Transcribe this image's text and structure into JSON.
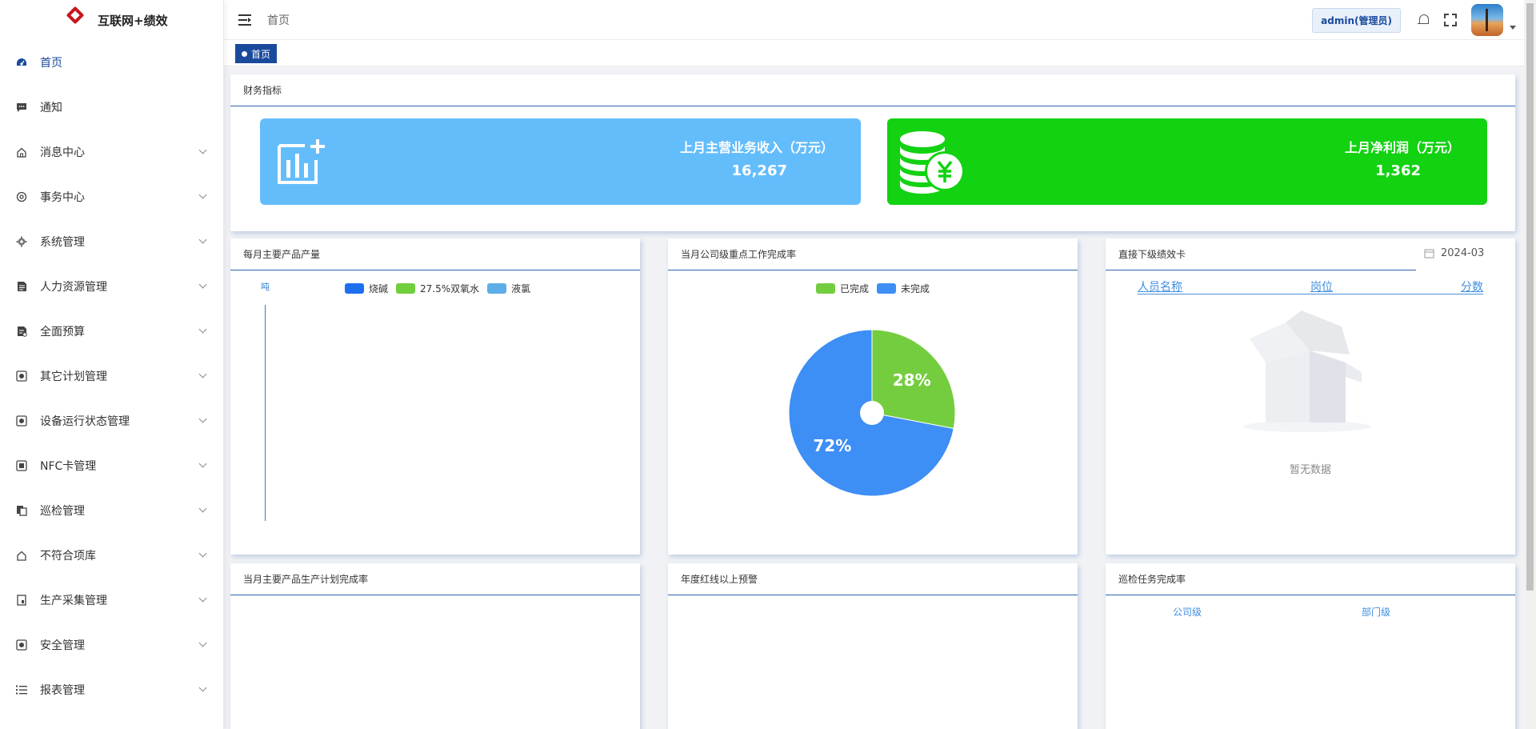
{
  "app": {
    "title": "互联网+绩效"
  },
  "sidebar": {
    "items": [
      {
        "label": "首页",
        "icon": "dashboard-icon",
        "active": true
      },
      {
        "label": "通知",
        "icon": "message-icon"
      },
      {
        "label": "消息中心",
        "icon": "home-icon"
      },
      {
        "label": "事务中心",
        "icon": "settings-circle-icon"
      },
      {
        "label": "系统管理",
        "icon": "gear-icon"
      },
      {
        "label": "人力资源管理",
        "icon": "document-icon"
      },
      {
        "label": "全面预算",
        "icon": "budget-doc-icon"
      },
      {
        "label": "其它计划管理",
        "icon": "plan-icon"
      },
      {
        "label": "设备运行状态管理",
        "icon": "device-icon"
      },
      {
        "label": "NFC卡管理",
        "icon": "nfc-icon"
      },
      {
        "label": "巡检管理",
        "icon": "copy-icon"
      },
      {
        "label": "不符合项库",
        "icon": "house-icon"
      },
      {
        "label": "生产采集管理",
        "icon": "collect-icon"
      },
      {
        "label": "安全管理",
        "icon": "safety-icon"
      },
      {
        "label": "报表管理",
        "icon": "list-icon"
      }
    ]
  },
  "header": {
    "breadcrumb": "首页",
    "user_label": "admin(管理员)"
  },
  "tags": {
    "active": "首页"
  },
  "finance": {
    "title": "财务指标",
    "revenue": {
      "label": "上月主营业务收入（万元）",
      "value": "16,267",
      "color": "#64bdfb"
    },
    "profit": {
      "label": "上月净利润（万元）",
      "value": "1,362",
      "color": "#12d212"
    }
  },
  "output_card": {
    "title": "每月主要产品产量",
    "unit": "吨",
    "legend": [
      {
        "name": "烧碱",
        "color": "#1e6ff0"
      },
      {
        "name": "27.5%双氧水",
        "color": "#6fcf3c"
      },
      {
        "name": "液氯",
        "color": "#5dade8"
      }
    ]
  },
  "completion_card": {
    "title": "当月公司级重点工作完成率",
    "legend": [
      {
        "name": "已完成",
        "color": "#74cd3f"
      },
      {
        "name": "未完成",
        "color": "#3d8ef5"
      }
    ]
  },
  "chart_data": {
    "type": "pie",
    "labels": [
      "已完成",
      "未完成"
    ],
    "values": [
      28,
      72
    ],
    "colors": [
      "#74cd3f",
      "#3d8ef5"
    ],
    "data_labels": [
      "28%",
      "72%"
    ]
  },
  "perf_card": {
    "title": "直接下级绩效卡",
    "date": "2024-03",
    "columns": [
      "人员名称",
      "岗位",
      "分数"
    ],
    "empty_text": "暂无数据"
  },
  "plan_card": {
    "title": "当月主要产品生产计划完成率"
  },
  "redline_card": {
    "title": "年度红线以上预警"
  },
  "inspect_card": {
    "title": "巡检任务完成率",
    "tabs": [
      "公司级",
      "部门级"
    ]
  }
}
